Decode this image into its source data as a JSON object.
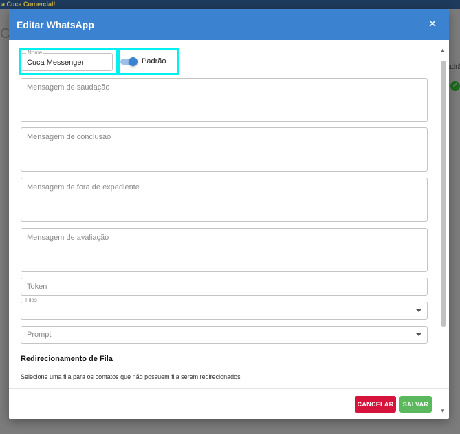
{
  "background": {
    "topbar_text": "a Cuca Comercial!",
    "title_fragment": "C",
    "column_fragment": "adrã"
  },
  "dialog": {
    "title": "Editar WhatsApp",
    "close_symbol": "×",
    "name": {
      "legend": "Nome",
      "value": "Cuca Messenger"
    },
    "default_toggle": {
      "label": "Padrão",
      "checked": true
    },
    "greeting_message": {
      "placeholder": "Mensagem de saudação"
    },
    "completion_message": {
      "placeholder": "Mensagem de conclusão"
    },
    "out_of_hours_message": {
      "placeholder": "Mensagem de fora de expediente"
    },
    "rating_message": {
      "placeholder": "Mensagem de avaliação"
    },
    "token": {
      "placeholder": "Token"
    },
    "queues": {
      "legend": "Filas",
      "value": ""
    },
    "prompt": {
      "placeholder": "Prompt",
      "value": ""
    },
    "redirect_section": {
      "title": "Redirecionamento de Fila",
      "description": "Selecione uma fila para os contatos que não possuem fila serem redirecionados"
    },
    "buttons": {
      "cancel": "CANCELAR",
      "save": "SALVAR"
    }
  },
  "colors": {
    "header": "#3b82d1",
    "highlight": "#00f0f0",
    "cancel": "#d6133a",
    "save": "#5cb85c"
  }
}
